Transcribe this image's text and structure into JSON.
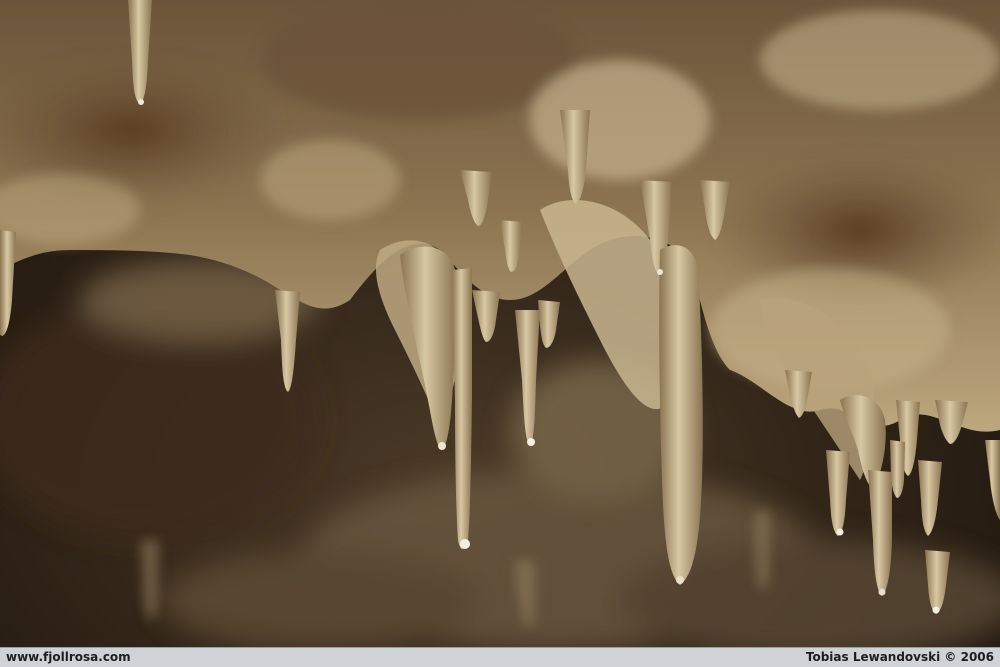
{
  "photo": {
    "subject": "cave stalactites",
    "palette": {
      "dark_background": "#2a1f14",
      "rock_brown": "#5b432b",
      "flowstone_light": "#cbb995",
      "flowstone_highlight": "#e6dcc2",
      "shadow": "#120c07"
    }
  },
  "caption": {
    "website": "www.fjollrosa.com",
    "credit": "Tobias Lewandovski © 2006",
    "bar_color": "#cfd2d6",
    "text_color": "#1e1e1e"
  }
}
